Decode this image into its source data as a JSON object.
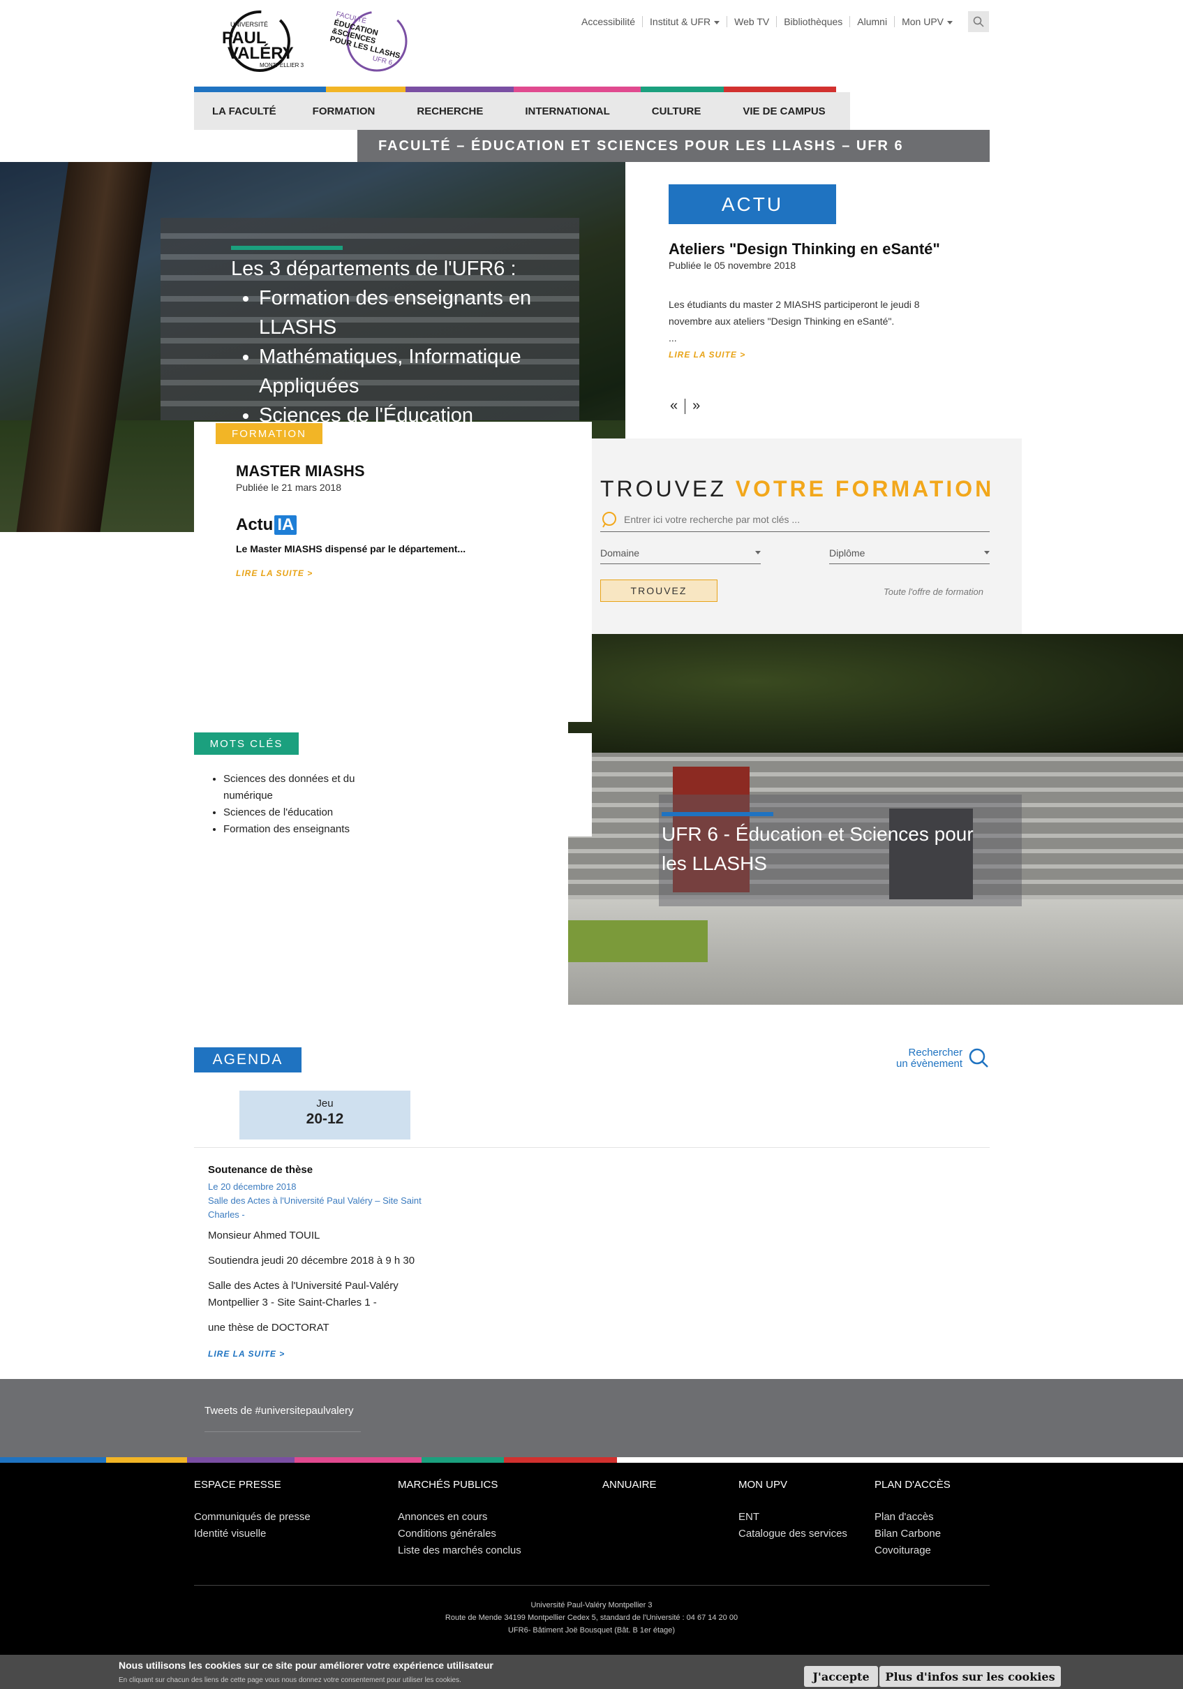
{
  "header": {
    "top_links": [
      "Accessibilité",
      "Institut & UFR",
      "Web TV",
      "Bibliothèques",
      "Alumni",
      "Mon UPV"
    ],
    "logo_upv": {
      "line1": "UNIVERSITÉ",
      "line2": "PAUL",
      "line3": "VALÉRY",
      "line4": "MONTPELLIER 3"
    },
    "logo_fac": {
      "line1": "FACULTÉ",
      "line2": "ÉDUCATION",
      "line3": "&SCIENCES",
      "line4": "POUR LES LLASHS",
      "line5": "UFR 6"
    }
  },
  "nav": {
    "items": [
      "LA FACULTÉ",
      "FORMATION",
      "RECHERCHE",
      "INTERNATIONAL",
      "CULTURE",
      "VIE DE CAMPUS"
    ],
    "colors": [
      "#1f73c1",
      "#f2b526",
      "#7a4fa3",
      "#e04a8f",
      "#1ba07e",
      "#d2312f"
    ]
  },
  "subheader": "FACULTÉ – ÉDUCATION ET SCIENCES POUR LES LLASHS – UFR 6",
  "hero": {
    "intro": "Les 3 départements de l'UFR6 :",
    "items": [
      "Formation des enseignants en LLASHS",
      "Mathématiques, Informatique Appliquées",
      "Sciences de l'Éducation"
    ]
  },
  "actu": {
    "tag": "ACTU",
    "title": "Ateliers \"Design Thinking en eSanté\"",
    "date": "Publiée le 05 novembre 2018",
    "body": "Les étudiants du master 2 MIASHS participeront le jeudi 8 novembre aux ateliers \"Design Thinking en eSanté\".",
    "ellipsis": "...",
    "read_more": "LIRE LA SUITE  >",
    "prev": "«",
    "next": "»"
  },
  "formation": {
    "tag": "FORMATION",
    "title": "MASTER MIASHS",
    "date": "Publiée le 21 mars 2018",
    "logo_text": "Actu",
    "logo_ia": "IA",
    "desc": "Le Master MIASHS dispensé par le département...",
    "read_more": "LIRE LA SUITE  >"
  },
  "search": {
    "title_a": "TROUVEZ ",
    "title_b": "VOTRE FORMATION",
    "placeholder": "Entrer ici votre recherche par mot clés ...",
    "domain": "Domaine",
    "diploma": "Diplôme",
    "button": "TROUVEZ",
    "all": "Toute l'offre de formation"
  },
  "building": {
    "caption": "UFR 6 - Éducation et Sciences pour les LLASHS"
  },
  "keywords": {
    "tag": "MOTS CLÉS",
    "items": [
      "Sciences des données et du numérique",
      "Sciences de l'éducation",
      "Formation des enseignants"
    ]
  },
  "agenda": {
    "tag": "AGENDA",
    "search_line1": "Rechercher",
    "search_line2": "un évènement",
    "day": "Jeu",
    "date": "20-12",
    "event_title": "Soutenance de thèse",
    "event_date": "Le 20 décembre 2018",
    "event_place": "Salle des Actes à l'Université Paul Valéry – Site Saint Charles -",
    "body": [
      "Monsieur Ahmed TOUIL",
      "Soutiendra jeudi 20 décembre 2018 à 9 h 30",
      "Salle des Actes à l'Université Paul-Valéry Montpellier 3 - Site Saint-Charles 1 -",
      "une thèse de DOCTORAT"
    ],
    "read_more": "LIRE LA SUITE  >"
  },
  "tweets": {
    "label": "Tweets de #universitepaulvalery"
  },
  "footer": {
    "columns": [
      {
        "title": "ESPACE PRESSE",
        "links": [
          "Communiqués de presse",
          "Identité visuelle"
        ]
      },
      {
        "title": "MARCHÉS PUBLICS",
        "links": [
          "Annonces en cours",
          "Conditions générales",
          "Liste des marchés conclus"
        ]
      },
      {
        "title": "ANNUAIRE",
        "links": []
      },
      {
        "title": "MON UPV",
        "links": [
          "ENT",
          "Catalogue des services"
        ]
      },
      {
        "title": "PLAN D'ACCÈS",
        "links": [
          "Plan d'accès",
          "Bilan Carbone",
          "Covoiturage"
        ]
      }
    ],
    "address": [
      "Université Paul-Valéry Montpellier 3",
      "Route de Mende 34199 Montpellier Cedex 5, standard de l'Université : 04 67 14 20 00",
      "UFR6- Bâtiment Joë Bousquet (Bât. B 1er étage)"
    ]
  },
  "cookie": {
    "title": "Nous utilisons les cookies sur ce site pour améliorer votre expérience utilisateur",
    "subtitle": "En cliquant sur chacun des liens de cette page vous nous donnez votre consentement pour utiliser les cookies.",
    "accept": "J'accepte",
    "more": "Plus d'infos sur les cookies"
  },
  "colors": {
    "blue": "#1f73c1",
    "orange": "#f2b526",
    "green": "#1ba07e",
    "grey": "#6d6e71"
  }
}
